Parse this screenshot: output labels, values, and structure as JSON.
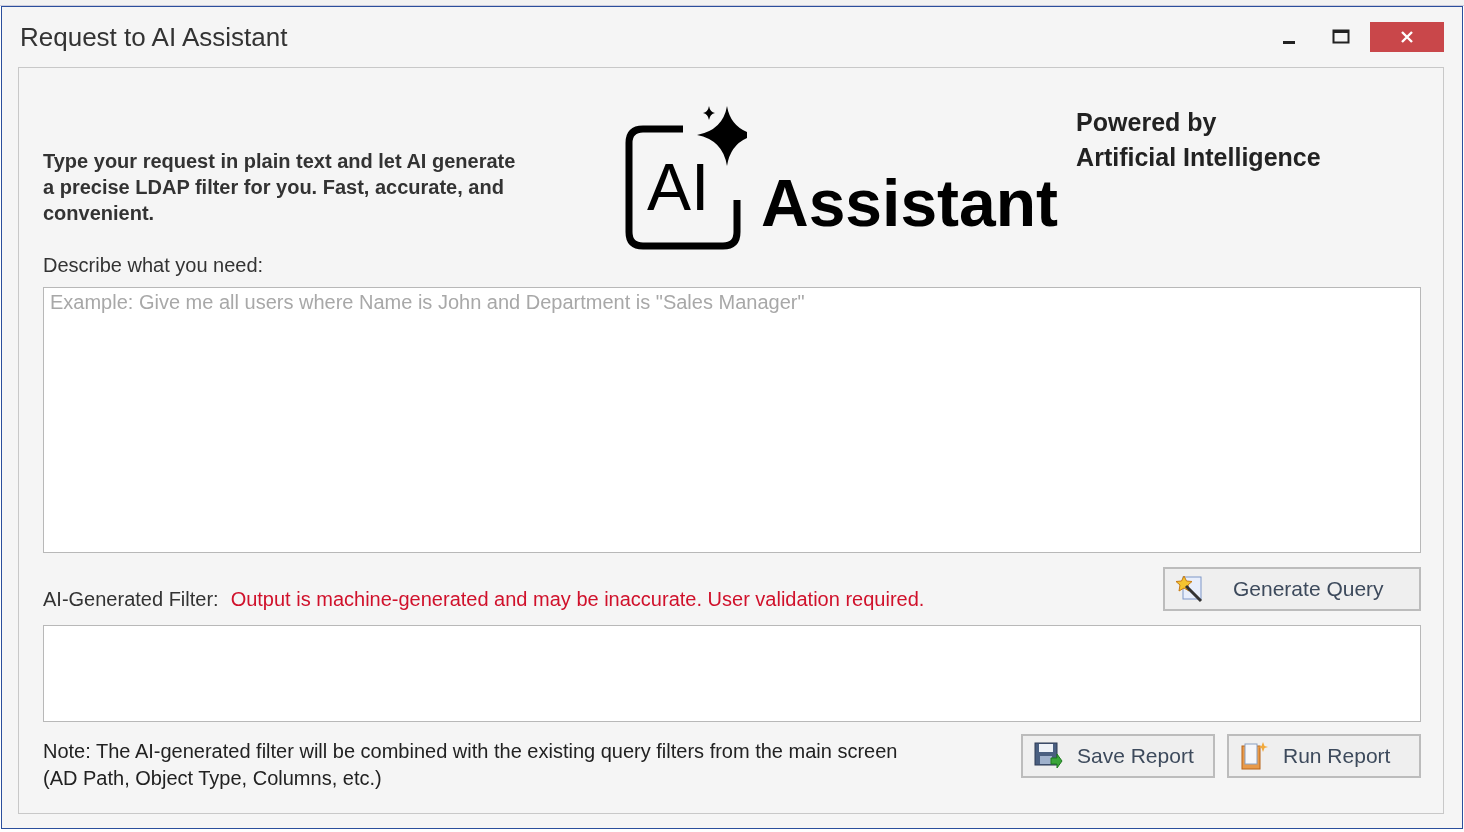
{
  "window": {
    "title": "Request to AI Assistant"
  },
  "intro": "Type your request in plain text and let AI generate a precise LDAP filter for you. Fast, accurate, and convenient.",
  "logo": {
    "badge": "AI",
    "name": "Assistant"
  },
  "powered_by": [
    "Powered by",
    "Artificial Intelligence"
  ],
  "request": {
    "label": "Describe what you need:",
    "placeholder": "Example: Give me all users where Name is John and Department is \"Sales Manager\""
  },
  "filter": {
    "label": "AI-Generated Filter:",
    "warning": "Output is machine-generated and may be inaccurate. User validation required."
  },
  "generate_button": "Generate Query",
  "note": "Note: The AI-generated filter will be combined with the existing query filters from the main screen (AD Path, Object Type, Columns, etc.)",
  "buttons": [
    {
      "kind": "save",
      "label": "Save Report"
    },
    {
      "kind": "run",
      "label": "Run Report"
    }
  ]
}
